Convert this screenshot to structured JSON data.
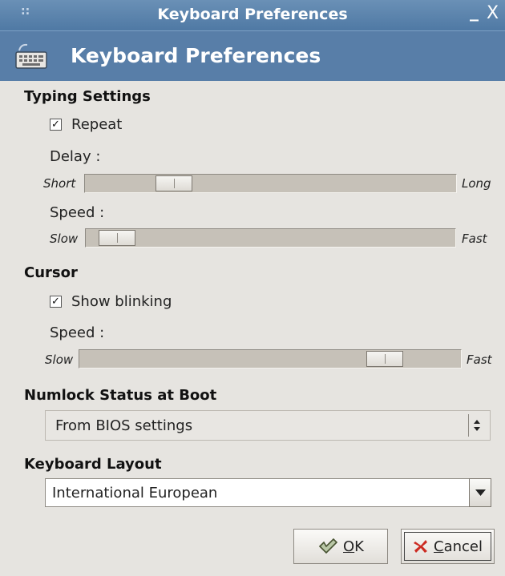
{
  "window": {
    "title": "Keyboard Preferences",
    "minimize_glyph": "_",
    "close_glyph": "X",
    "grip_glyph": "::"
  },
  "header": {
    "title": "Keyboard Preferences",
    "icon": "keyboard-icon"
  },
  "typing": {
    "section_title": "Typing Settings",
    "repeat": {
      "label": "Repeat",
      "checked": true
    },
    "delay": {
      "label": "Delay :",
      "min_label": "Short",
      "max_label": "Long",
      "value": 0.2
    },
    "speed": {
      "label": "Speed :",
      "min_label": "Slow",
      "max_label": "Fast",
      "value": 0.05
    }
  },
  "cursor": {
    "section_title": "Cursor",
    "blink": {
      "label": "Show blinking",
      "checked": true
    },
    "speed": {
      "label": "Speed :",
      "min_label": "Slow",
      "max_label": "Fast",
      "value": 0.78
    }
  },
  "numlock": {
    "section_title": "Numlock Status at Boot",
    "selected": "From BIOS settings"
  },
  "layout": {
    "section_title": "Keyboard Layout",
    "selected": "International European"
  },
  "buttons": {
    "ok": {
      "mnemonic": "O",
      "rest": "K",
      "icon": "checkmark-icon"
    },
    "cancel": {
      "mnemonic": "C",
      "rest": "ancel",
      "icon": "x-icon"
    }
  },
  "colors": {
    "titlebar": "#587ea8",
    "background": "#e6e4e0",
    "trough": "#c6c1b8"
  }
}
